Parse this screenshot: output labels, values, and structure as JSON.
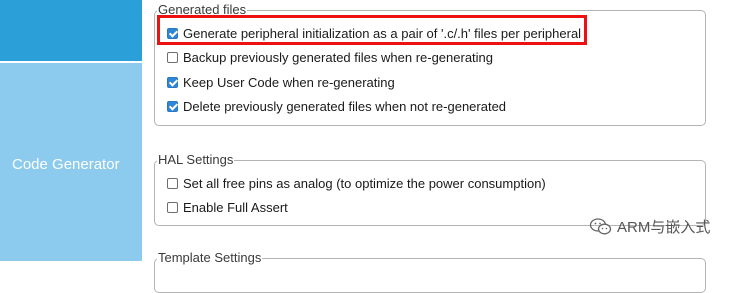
{
  "sidebar": {
    "active_label": "Code Generator"
  },
  "generated_files": {
    "legend": "Generated files",
    "options": [
      {
        "label": "Generate peripheral initialization as a pair of '.c/.h' files per peripheral",
        "checked": true
      },
      {
        "label": "Backup previously generated files when re-generating",
        "checked": false
      },
      {
        "label": "Keep User Code when re-generating",
        "checked": true
      },
      {
        "label": "Delete previously generated files when not re-generated",
        "checked": true
      }
    ]
  },
  "hal_settings": {
    "legend": "HAL Settings",
    "options": [
      {
        "label": "Set all free pins as analog (to optimize the power consumption)",
        "checked": false
      },
      {
        "label": "Enable Full Assert",
        "checked": false
      }
    ]
  },
  "template_settings": {
    "legend": "Template Settings"
  },
  "watermark": {
    "text": "ARM与嵌入式",
    "icon": "wechat-icon"
  },
  "colors": {
    "sidebar_active": "#2a9fd8",
    "sidebar": "#8ccbee",
    "checkbox_checked": "#2f86d4",
    "highlight": "#ee1111"
  }
}
